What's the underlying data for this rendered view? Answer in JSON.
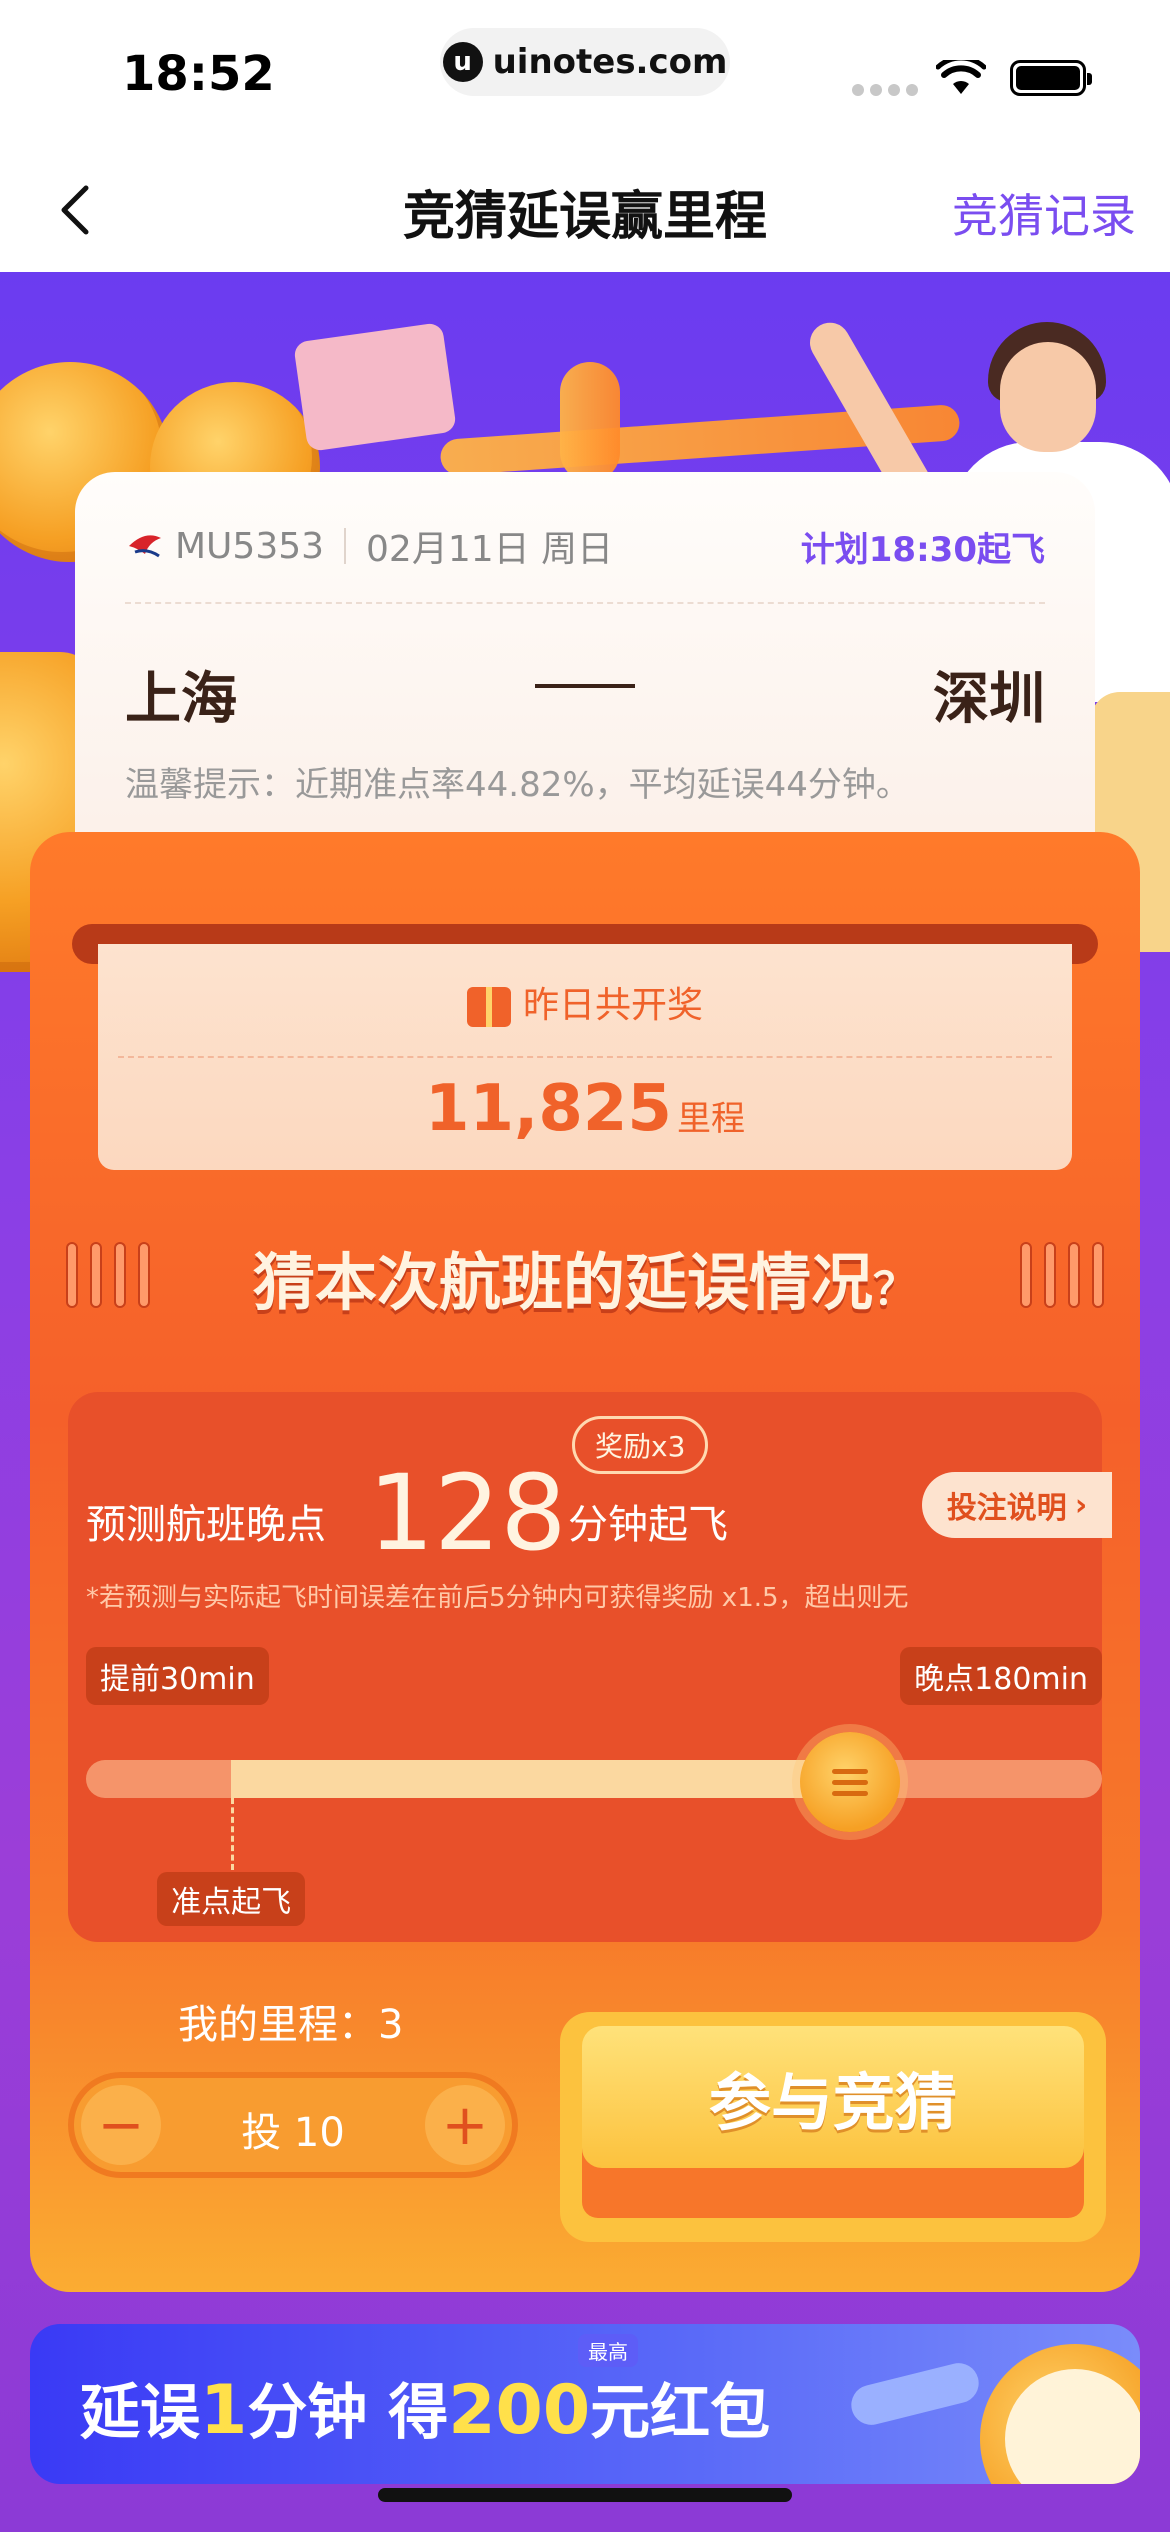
{
  "status_bar": {
    "time": "18:52",
    "url": "uinotes.com",
    "url_icon": "u"
  },
  "nav": {
    "title": "竞猜延误赢里程",
    "right_link": "竞猜记录"
  },
  "flight": {
    "number": "MU5353",
    "date": "02月11日 周日",
    "plan": "计划18:30起飞",
    "from": "上海",
    "to": "深圳",
    "tip": "温馨提示：近期准点率44.82%，平均延误44分钟。"
  },
  "prize": {
    "title": "昨日共开奖",
    "amount": "11,825",
    "unit": "里程"
  },
  "question": {
    "title": "猜本次航班的延误情况",
    "mark": "？"
  },
  "predict": {
    "label": "预测航班晚点",
    "value": "128",
    "unit": "分钟起飞",
    "bonus": "奖励x3",
    "rules_button": "投注说明",
    "note": "*若预测与实际起飞时间误差在前后5分钟内可获得奖励 x1.5，超出则无",
    "range_min_label": "提前30min",
    "range_max_label": "晚点180min",
    "ontime_label": "准点起飞",
    "slider_min": -30,
    "slider_max": 180,
    "slider_value": 128
  },
  "bet": {
    "my_miles_label": "我的里程：",
    "my_miles": "3",
    "minus": "−",
    "plus": "+",
    "stake": "投 10",
    "join_button": "参与竞猜"
  },
  "banner": {
    "part1": "延误",
    "num1": "1",
    "part2": "分钟 得",
    "num2": "200",
    "part3": "元红包",
    "badge": "最高"
  },
  "colors": {
    "accent": "#7a4df0",
    "orange": "#f5602a",
    "gold": "#fcc23e"
  }
}
